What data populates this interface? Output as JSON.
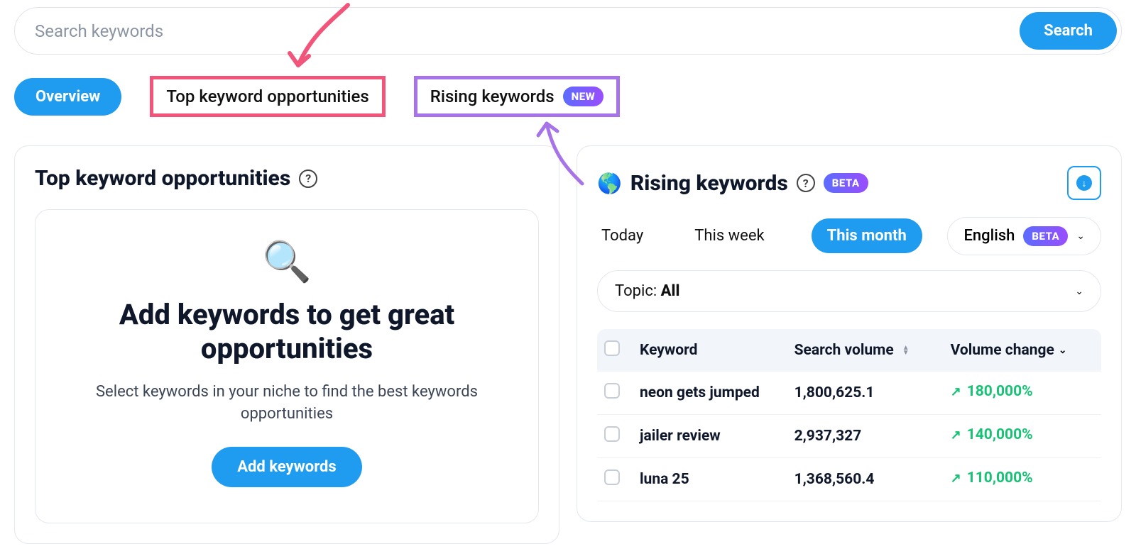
{
  "search": {
    "placeholder": "Search keywords",
    "button": "Search"
  },
  "tabs": {
    "overview": "Overview",
    "top_opportunities": "Top keyword opportunities",
    "rising": "Rising keywords",
    "new_badge": "NEW"
  },
  "left_panel": {
    "title": "Top keyword opportunities",
    "empty_title": "Add keywords to get great opportunities",
    "empty_sub": "Select keywords in your niche to find the best keywords opportunities",
    "add_button": "Add keywords"
  },
  "right_panel": {
    "globe": "🌎",
    "title": "Rising keywords",
    "beta_badge": "BETA",
    "timeframes": {
      "today": "Today",
      "week": "This week",
      "month": "This month"
    },
    "language": {
      "label": "English",
      "badge": "BETA"
    },
    "topic": {
      "prefix": "Topic: ",
      "value": "All"
    },
    "columns": {
      "keyword": "Keyword",
      "search_volume": "Search volume",
      "volume_change": "Volume change"
    },
    "rows": [
      {
        "keyword": "neon gets jumped",
        "search_volume": "1,800,625.1",
        "volume_change": "180,000%"
      },
      {
        "keyword": "jailer review",
        "search_volume": "2,937,327",
        "volume_change": "140,000%"
      },
      {
        "keyword": "luna 25",
        "search_volume": "1,368,560.4",
        "volume_change": "110,000%"
      }
    ]
  },
  "colors": {
    "primary": "#1f9cf0",
    "highlight_pink": "#f2557a",
    "highlight_purple": "#a673e8",
    "positive": "#17c275"
  }
}
